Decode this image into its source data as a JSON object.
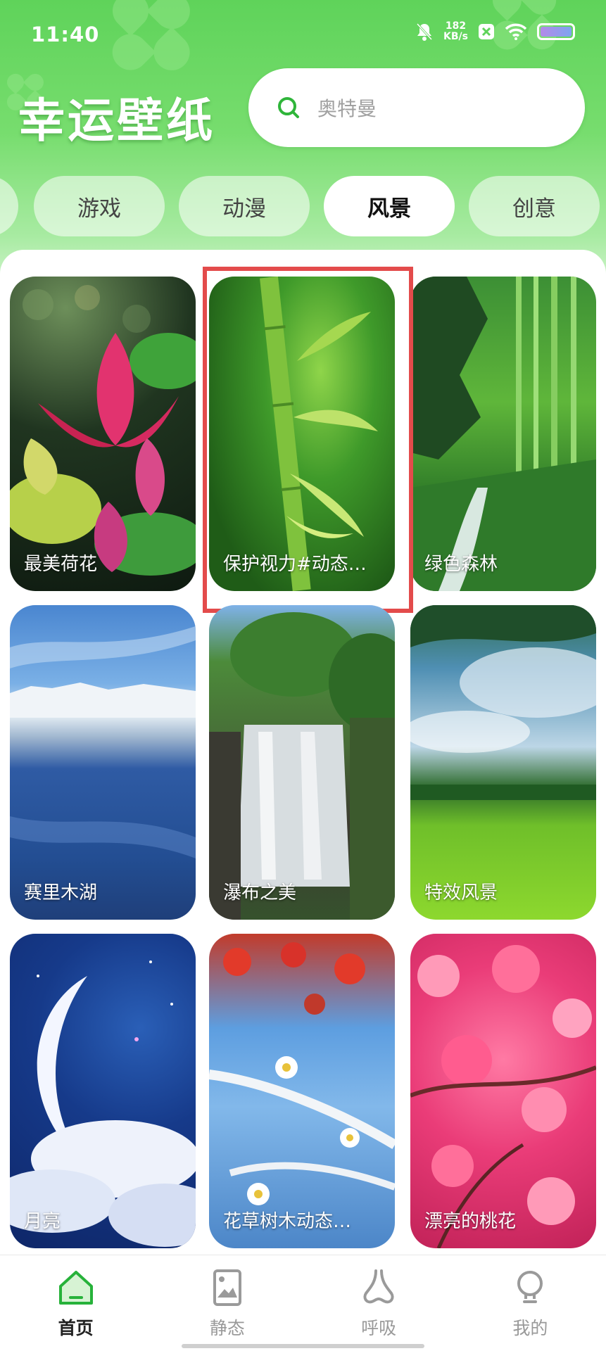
{
  "status_bar": {
    "time": "11:40",
    "net_speed_value": "182",
    "net_speed_unit": "KB/s",
    "icons": [
      "bell-mute-icon",
      "x-badge-icon",
      "wifi-icon",
      "battery-icon"
    ]
  },
  "header": {
    "app_title": "幸运壁纸",
    "search_placeholder": "奥特曼"
  },
  "tabs": {
    "items": [
      {
        "label": "游戏"
      },
      {
        "label": "动漫"
      },
      {
        "label": "风景"
      },
      {
        "label": "创意"
      }
    ],
    "active": "风景"
  },
  "wallpapers": [
    {
      "label": "最美荷花"
    },
    {
      "label": "保护视力#动态…"
    },
    {
      "label": "绿色森林"
    },
    {
      "label": "赛里木湖"
    },
    {
      "label": "瀑布之美"
    },
    {
      "label": "特效风景"
    },
    {
      "label": "月亮"
    },
    {
      "label": "花草树木动态…"
    },
    {
      "label": "漂亮的桃花"
    }
  ],
  "bottom_nav": {
    "items": [
      {
        "label": "首页",
        "icon": "home-icon"
      },
      {
        "label": "静态",
        "icon": "image-icon"
      },
      {
        "label": "呼吸",
        "icon": "nose-icon"
      },
      {
        "label": "我的",
        "icon": "profile-icon"
      }
    ],
    "active": "首页"
  },
  "colors": {
    "brand_green": "#5fd35a",
    "highlight_red": "#e34b4b"
  }
}
